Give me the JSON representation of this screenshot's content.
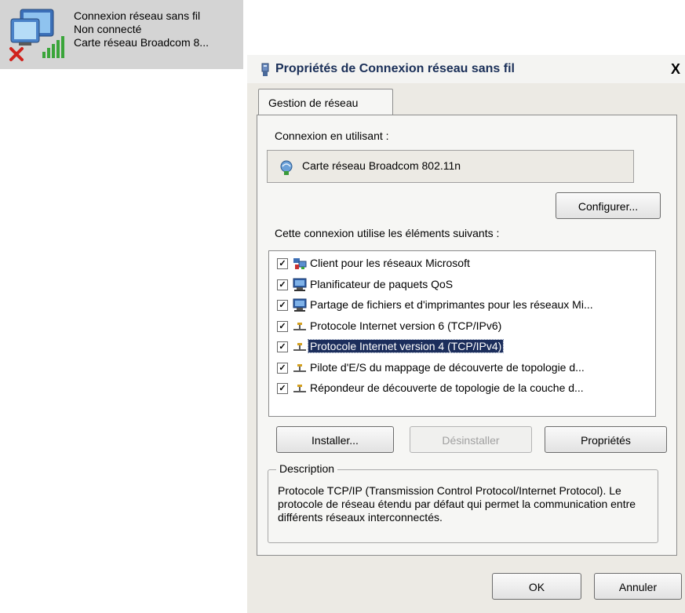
{
  "connection_tile": {
    "name": "Connexion réseau sans fil",
    "status": "Non connecté",
    "adapter": "Carte réseau Broadcom 8..."
  },
  "dialog": {
    "title": "Propriétés de Connexion réseau sans fil",
    "close": "X",
    "tab": "Gestion de réseau",
    "connect_using_label": "Connexion en utilisant :",
    "adapter_name": "Carte réseau Broadcom 802.11n",
    "configure_button": "Configurer...",
    "items_label": "Cette connexion utilise les éléments suivants :",
    "items": [
      {
        "label": "Client pour les réseaux Microsoft",
        "checked": true,
        "icon": "network-client-icon"
      },
      {
        "label": "Planificateur de paquets QoS",
        "checked": true,
        "icon": "service-icon"
      },
      {
        "label": "Partage de fichiers et d'imprimantes pour les réseaux Mi...",
        "checked": true,
        "icon": "service-icon"
      },
      {
        "label": "Protocole Internet version 6 (TCP/IPv6)",
        "checked": true,
        "icon": "protocol-icon"
      },
      {
        "label": "Protocole Internet version 4 (TCP/IPv4)",
        "checked": true,
        "icon": "protocol-icon",
        "selected": true
      },
      {
        "label": "Pilote d'E/S du mappage de découverte de topologie d...",
        "checked": true,
        "icon": "protocol-icon"
      },
      {
        "label": "Répondeur de découverte de topologie de la couche d...",
        "checked": true,
        "icon": "protocol-icon"
      }
    ],
    "install_button": "Installer...",
    "uninstall_button": "Désinstaller",
    "properties_button": "Propriétés",
    "description_title": "Description",
    "description_text": "Protocole TCP/IP (Transmission Control Protocol/Internet Protocol). Le protocole de réseau étendu par défaut qui permet la communication entre différents réseaux interconnectés.",
    "ok_button": "OK",
    "cancel_button": "Annuler"
  },
  "colors": {
    "selection": "#1c2e5c",
    "title_text": "#1a2f58",
    "dialog_bg": "#eceae4"
  }
}
